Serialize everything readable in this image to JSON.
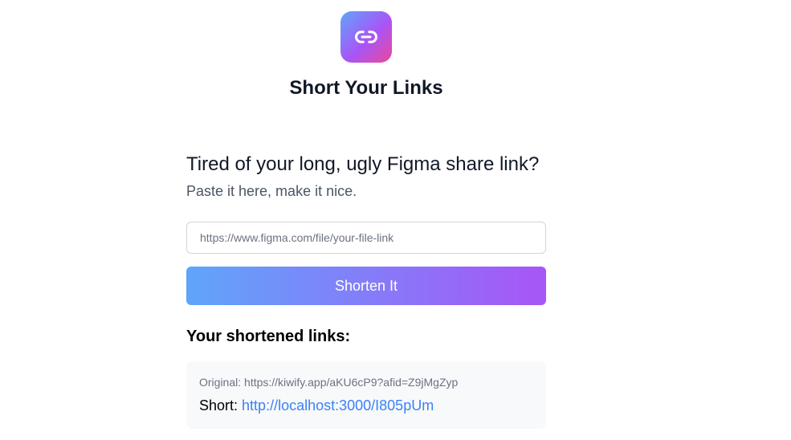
{
  "header": {
    "logo_icon": "link-icon",
    "logo_gradient": [
      "#60a5fa",
      "#a855f7",
      "#ec4899"
    ],
    "title": "Short Your Links"
  },
  "hero": {
    "headline": "Tired of your long, ugly Figma share link?",
    "subheadline": "Paste it here, make it nice."
  },
  "form": {
    "url_value": "",
    "url_placeholder": "https://www.figma.com/file/your-file-link",
    "submit_label": "Shorten It"
  },
  "results": {
    "heading": "Your shortened links:",
    "links": [
      {
        "original_label": "Original:",
        "original_url": "https://kiwify.app/aKU6cP9?afid=Z9jMgZyp",
        "short_label": "Short:",
        "short_url": "http://localhost:3000/I805pUm"
      }
    ]
  },
  "colors": {
    "accent_start": "#60a5fa",
    "accent_end": "#a855f7",
    "link": "#3b82f6",
    "card_bg": "#f8f9fb"
  }
}
